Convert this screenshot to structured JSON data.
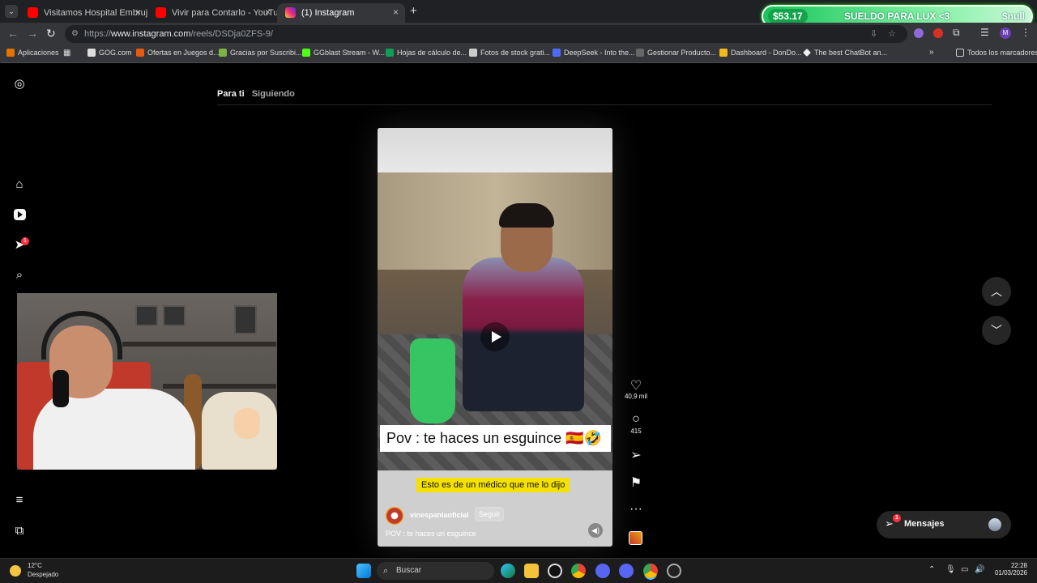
{
  "browser": {
    "tabs": [
      {
        "title": "Visitamos Hospital Embrujado",
        "active": false
      },
      {
        "title": "Vivir para Contarlo - YouTube",
        "active": false
      },
      {
        "title": "(1) Instagram",
        "active": true
      }
    ],
    "new_tab": "+",
    "url_prefix": "https://",
    "url_host": "www.instagram.com",
    "url_path": "/reels/DSDja0ZFS-9/",
    "bookmarks": [
      "Aplicaciones",
      "GOG.com",
      "Ofertas en Juegos d...",
      "Gracias por Suscribi...",
      "GGblast Stream - W...",
      "Hojas de cálculo de...",
      "Fotos de stock grati...",
      "DeepSeek - Into the...",
      "Gestionar Producto...",
      "Dashboard - DonDo...",
      "The best ChatBot an..."
    ],
    "bookmarks_more": "»",
    "all_bookmarks": "Todos los marcadores"
  },
  "overlay": {
    "money": "$53.17",
    "goal": "SUELDO PARA LUX <3",
    "brand": "$null"
  },
  "instagram": {
    "feed_tabs": {
      "for_you": "Para ti",
      "following": "Siguiendo"
    },
    "notifications_badge": "1",
    "reel": {
      "caption_overlay": "Pov : te haces un esguince 🇪🇸🤣",
      "subtitle": "Esto es de un médico que me lo dijo",
      "author": "vinespaniaoficial",
      "follow": "Seguir",
      "description": "POV : te haces un esguince"
    },
    "actions": {
      "likes": "40,9 mil",
      "comments": "415"
    },
    "messages": {
      "label": "Mensajes",
      "badge": "1"
    }
  },
  "taskbar": {
    "temperature": "12°C",
    "weather": "Despejado",
    "search_placeholder": "Buscar",
    "time": "22:28",
    "date": "01/03/2026"
  }
}
